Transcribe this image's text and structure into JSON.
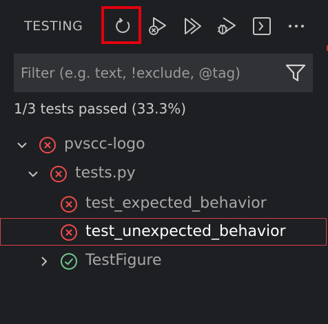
{
  "header": {
    "title": "TESTING",
    "actions": [
      {
        "name": "refresh-tests",
        "icon": "refresh-icon"
      },
      {
        "name": "run-failed-tests",
        "icon": "run-failed-icon"
      },
      {
        "name": "run-all-tests",
        "icon": "run-all-icon"
      },
      {
        "name": "debug-all-tests",
        "icon": "debug-all-icon"
      },
      {
        "name": "show-output",
        "icon": "terminal-icon"
      },
      {
        "name": "more-actions",
        "icon": "ellipsis-icon"
      }
    ]
  },
  "filter": {
    "placeholder": "Filter (e.g. text, !exclude, @tag)",
    "value": "",
    "icon": "funnel-icon"
  },
  "summary": "1/3 tests passed (33.3%)",
  "tree": [
    {
      "label": "pvscc-logo",
      "status": "failed",
      "expanded": true,
      "level": 0
    },
    {
      "label": "tests.py",
      "status": "failed",
      "expanded": true,
      "level": 1
    },
    {
      "label": "test_expected_behavior",
      "status": "failed",
      "level": 2
    },
    {
      "label": "test_unexpected_behavior",
      "status": "failed",
      "level": 2,
      "selected": true
    },
    {
      "label": "TestFigure",
      "status": "passed",
      "expanded": false,
      "level": 1
    }
  ],
  "colors": {
    "failed": "#f14c4c",
    "passed": "#73c991",
    "highlight": "#e3000f"
  }
}
